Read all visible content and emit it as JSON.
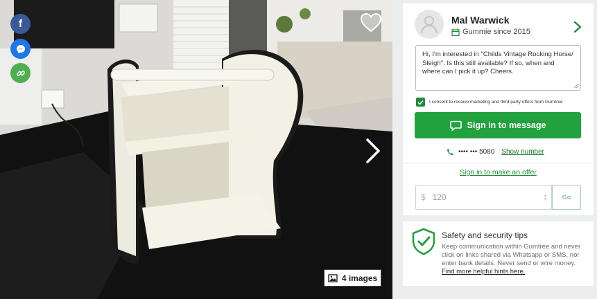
{
  "gallery": {
    "image_count_label": "4 images",
    "share": {
      "facebook_glyph": "f",
      "messenger_glyph": "✓",
      "link_glyph": "🔗"
    }
  },
  "seller": {
    "name": "Mal Warwick",
    "member_since": "Gummie since 2015"
  },
  "message": {
    "text": "Hi, I'm interested in \"Childs Vintage Rocking Horse/ Sleigh\". Is this still available? If so, when and where can I pick it up? Cheers."
  },
  "consent": {
    "label": "I consent to receive marketing and third party offers from Gumtree",
    "checked": true
  },
  "actions": {
    "signin_message": "Sign in to message",
    "phone_masked": "•••• ••• 5080",
    "show_number": "Show number",
    "signin_offer": "Sign in to make an offer"
  },
  "offer": {
    "currency": "$",
    "value": "120",
    "go": "Go"
  },
  "safety": {
    "title": "Safety and security tips",
    "body": "Keep communication within Gumtree and never click on links shared via Whatsapp or SMS, nor enter bank details. Never send or wire money.",
    "link": "Find more helpful hints here."
  },
  "colors": {
    "brand_green": "#21a23f",
    "link_green": "#208b3a",
    "facebook": "#3b5998",
    "messenger": "#1e76e8"
  }
}
